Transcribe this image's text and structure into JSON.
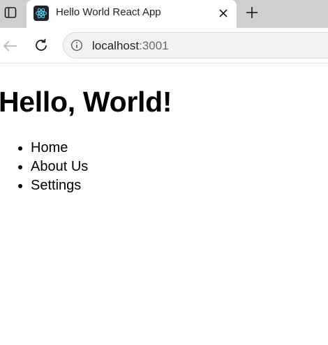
{
  "browser": {
    "tab": {
      "title": "Hello World React App",
      "favicon": "react-logo-icon",
      "close_icon": "close-icon"
    },
    "new_tab_icon": "plus-icon",
    "tab_actions_icon": "tab-actions-icon",
    "toolbar": {
      "back_icon": "arrow-left-icon",
      "reload_icon": "reload-icon",
      "site_info_icon": "info-icon",
      "url_host": "localhost",
      "url_port": ":3001"
    },
    "colors": {
      "tabstrip_bg": "#cfcfcf",
      "active_tab_bg": "#ffffff",
      "react_blue": "#61dafb"
    }
  },
  "page": {
    "heading": "Hello, World!",
    "nav_items": [
      {
        "label": "Home"
      },
      {
        "label": "About Us"
      },
      {
        "label": "Settings"
      }
    ]
  }
}
